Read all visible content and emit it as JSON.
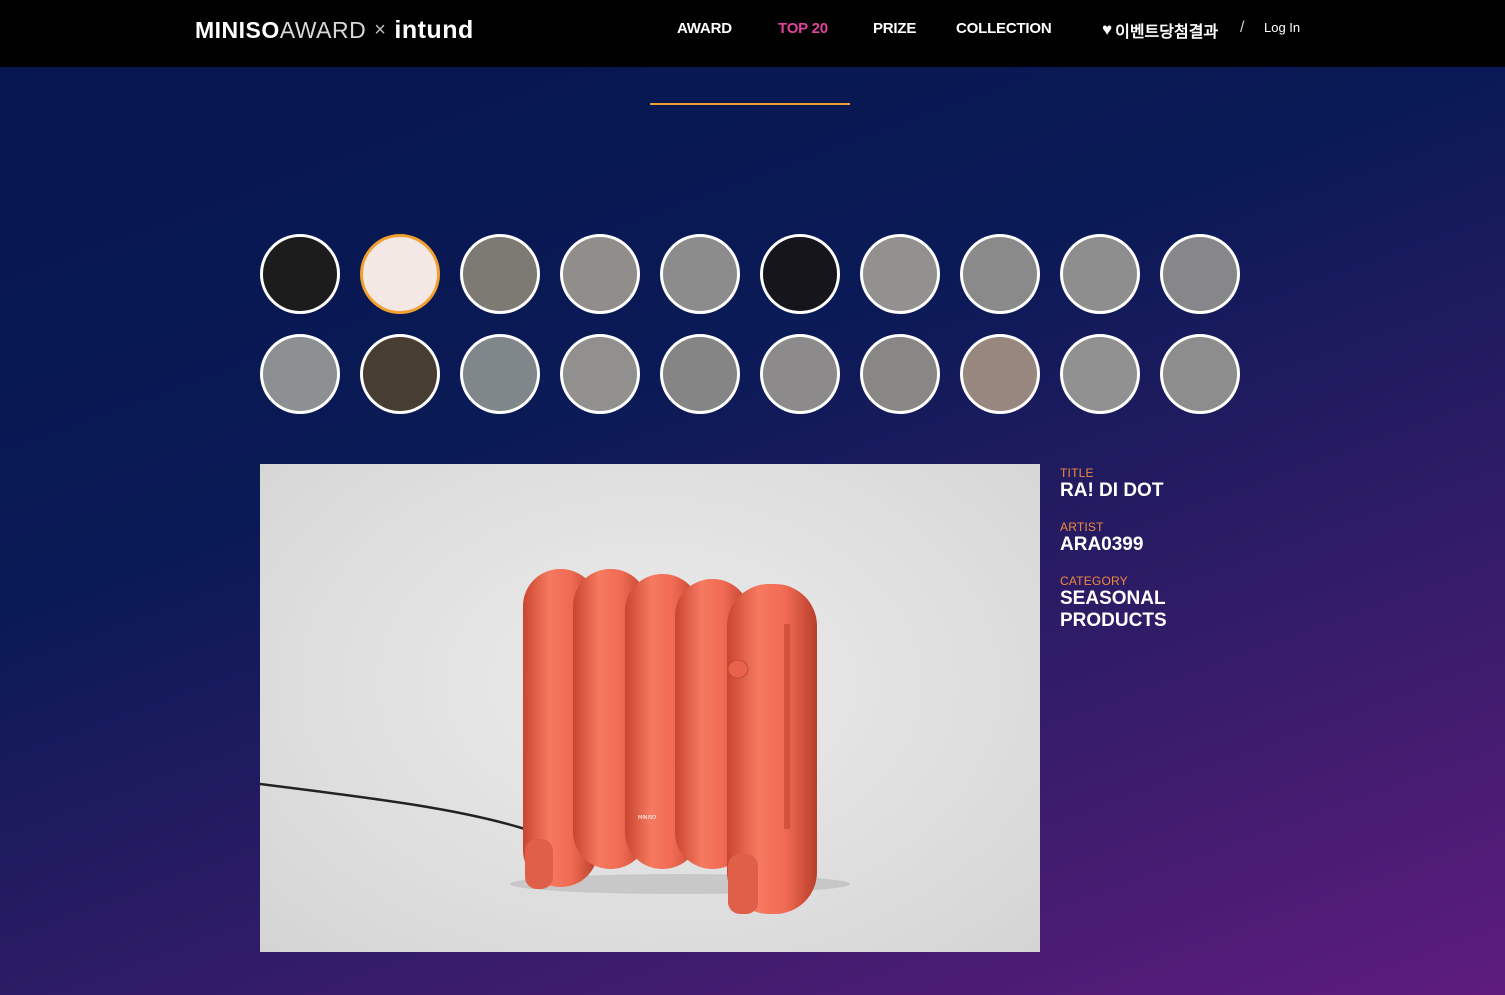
{
  "header": {
    "logo_part1": "MINISO",
    "logo_part2": "AWARD",
    "logo_x": "×",
    "logo_part3": "intund",
    "nav": [
      {
        "label": "AWARD"
      },
      {
        "label": "TOP 20"
      },
      {
        "label": "PRIZE"
      },
      {
        "label": "COLLECTION"
      }
    ],
    "active_nav": "TOP 20",
    "event_label": "이벤트당첨결과",
    "separator": "/",
    "login_label": "Log In"
  },
  "colors": {
    "accent_active": "#e0449a",
    "accent_orange": "#f0a030",
    "label_orange": "#f08a3c"
  },
  "thumbnails": [
    {
      "name": "thumb-1",
      "bg": "#2a2a2a"
    },
    {
      "name": "thumb-2",
      "bg": "#f4e8e4"
    },
    {
      "name": "thumb-3",
      "bg": "#b8b4ac"
    },
    {
      "name": "thumb-4",
      "bg": "#d4d0cc"
    },
    {
      "name": "thumb-5",
      "bg": "#cfcfcf"
    },
    {
      "name": "thumb-6",
      "bg": "#202028"
    },
    {
      "name": "thumb-7",
      "bg": "#d8d6d4"
    },
    {
      "name": "thumb-8",
      "bg": "#cccccc"
    },
    {
      "name": "thumb-9",
      "bg": "#d2d2d2"
    },
    {
      "name": "thumb-10",
      "bg": "#c8c8cc"
    },
    {
      "name": "thumb-11",
      "bg": "#cfd4d8"
    },
    {
      "name": "thumb-12",
      "bg": "#6a5a4c"
    },
    {
      "name": "thumb-13",
      "bg": "#bcc8cc"
    },
    {
      "name": "thumb-14",
      "bg": "#d6d4d2"
    },
    {
      "name": "thumb-15",
      "bg": "#c4c4c4"
    },
    {
      "name": "thumb-16",
      "bg": "#cecccc"
    },
    {
      "name": "thumb-17",
      "bg": "#cac8c6"
    },
    {
      "name": "thumb-18",
      "bg": "#e0c8bc"
    },
    {
      "name": "thumb-19",
      "bg": "#d6d6d8"
    },
    {
      "name": "thumb-20",
      "bg": "#d0d0d0"
    }
  ],
  "selected_index": 1,
  "artwork": {
    "title_label": "TITLE",
    "title": "RA! DI DOT",
    "artist_label": "ARTIST",
    "artist": "ARA0399",
    "category_label": "CATEGORY",
    "category": "SEASONAL PRODUCTS",
    "brand_mark": "MINISO",
    "product_color": "#f06a52"
  }
}
